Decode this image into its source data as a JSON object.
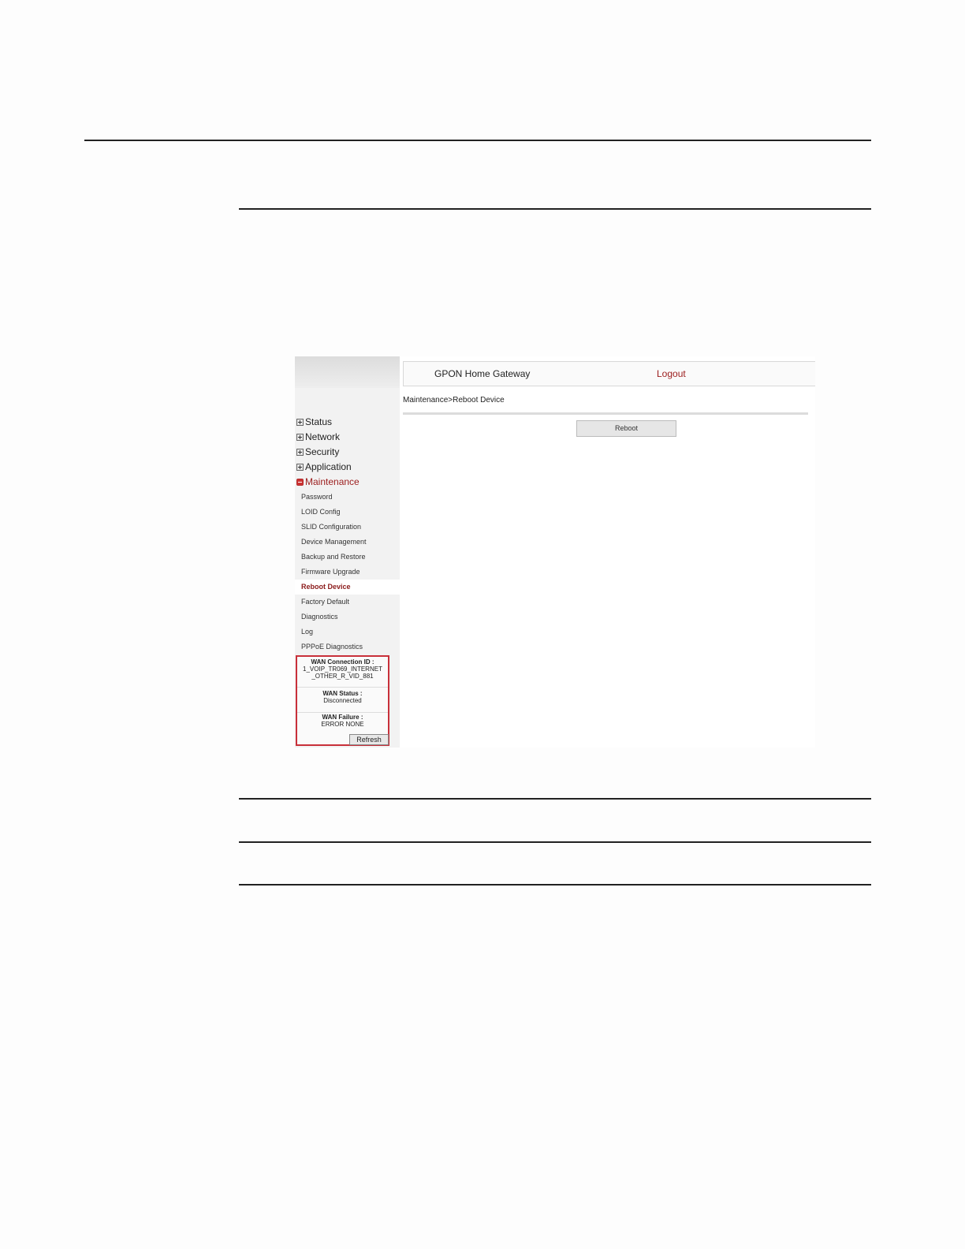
{
  "app": {
    "title": "GPON Home Gateway",
    "logout_label": "Logout"
  },
  "breadcrumb": "Maintenance>Reboot Device",
  "actions": {
    "reboot_label": "Reboot"
  },
  "sidebar": {
    "menu": [
      {
        "label": "Status",
        "icon": "expand-plus-icon"
      },
      {
        "label": "Network",
        "icon": "expand-plus-icon"
      },
      {
        "label": "Security",
        "icon": "expand-plus-icon"
      },
      {
        "label": "Application",
        "icon": "expand-plus-icon"
      },
      {
        "label": "Maintenance",
        "icon": "collapse-minus-icon"
      }
    ],
    "submenu": [
      {
        "label": "Password"
      },
      {
        "label": "LOID Config"
      },
      {
        "label": "SLID Configuration"
      },
      {
        "label": "Device Management"
      },
      {
        "label": "Backup and Restore"
      },
      {
        "label": "Firmware Upgrade"
      },
      {
        "label": "Reboot Device"
      },
      {
        "label": "Factory Default"
      },
      {
        "label": "Diagnostics"
      },
      {
        "label": "Log"
      },
      {
        "label": "PPPoE Diagnostics"
      }
    ]
  },
  "wan": {
    "connection_label": "WAN Connection ID :",
    "connection_value_1": "1_VOIP_TR069_INTERNET",
    "connection_value_2": "_OTHER_R_VID_881",
    "status_label": "WAN Status :",
    "status_value": "Disconnected",
    "failure_label": "WAN Failure :",
    "failure_value": "ERROR NONE",
    "refresh_label": "Refresh"
  },
  "colors": {
    "accent": "#9b1c1c",
    "wan_border": "#c8303a"
  }
}
